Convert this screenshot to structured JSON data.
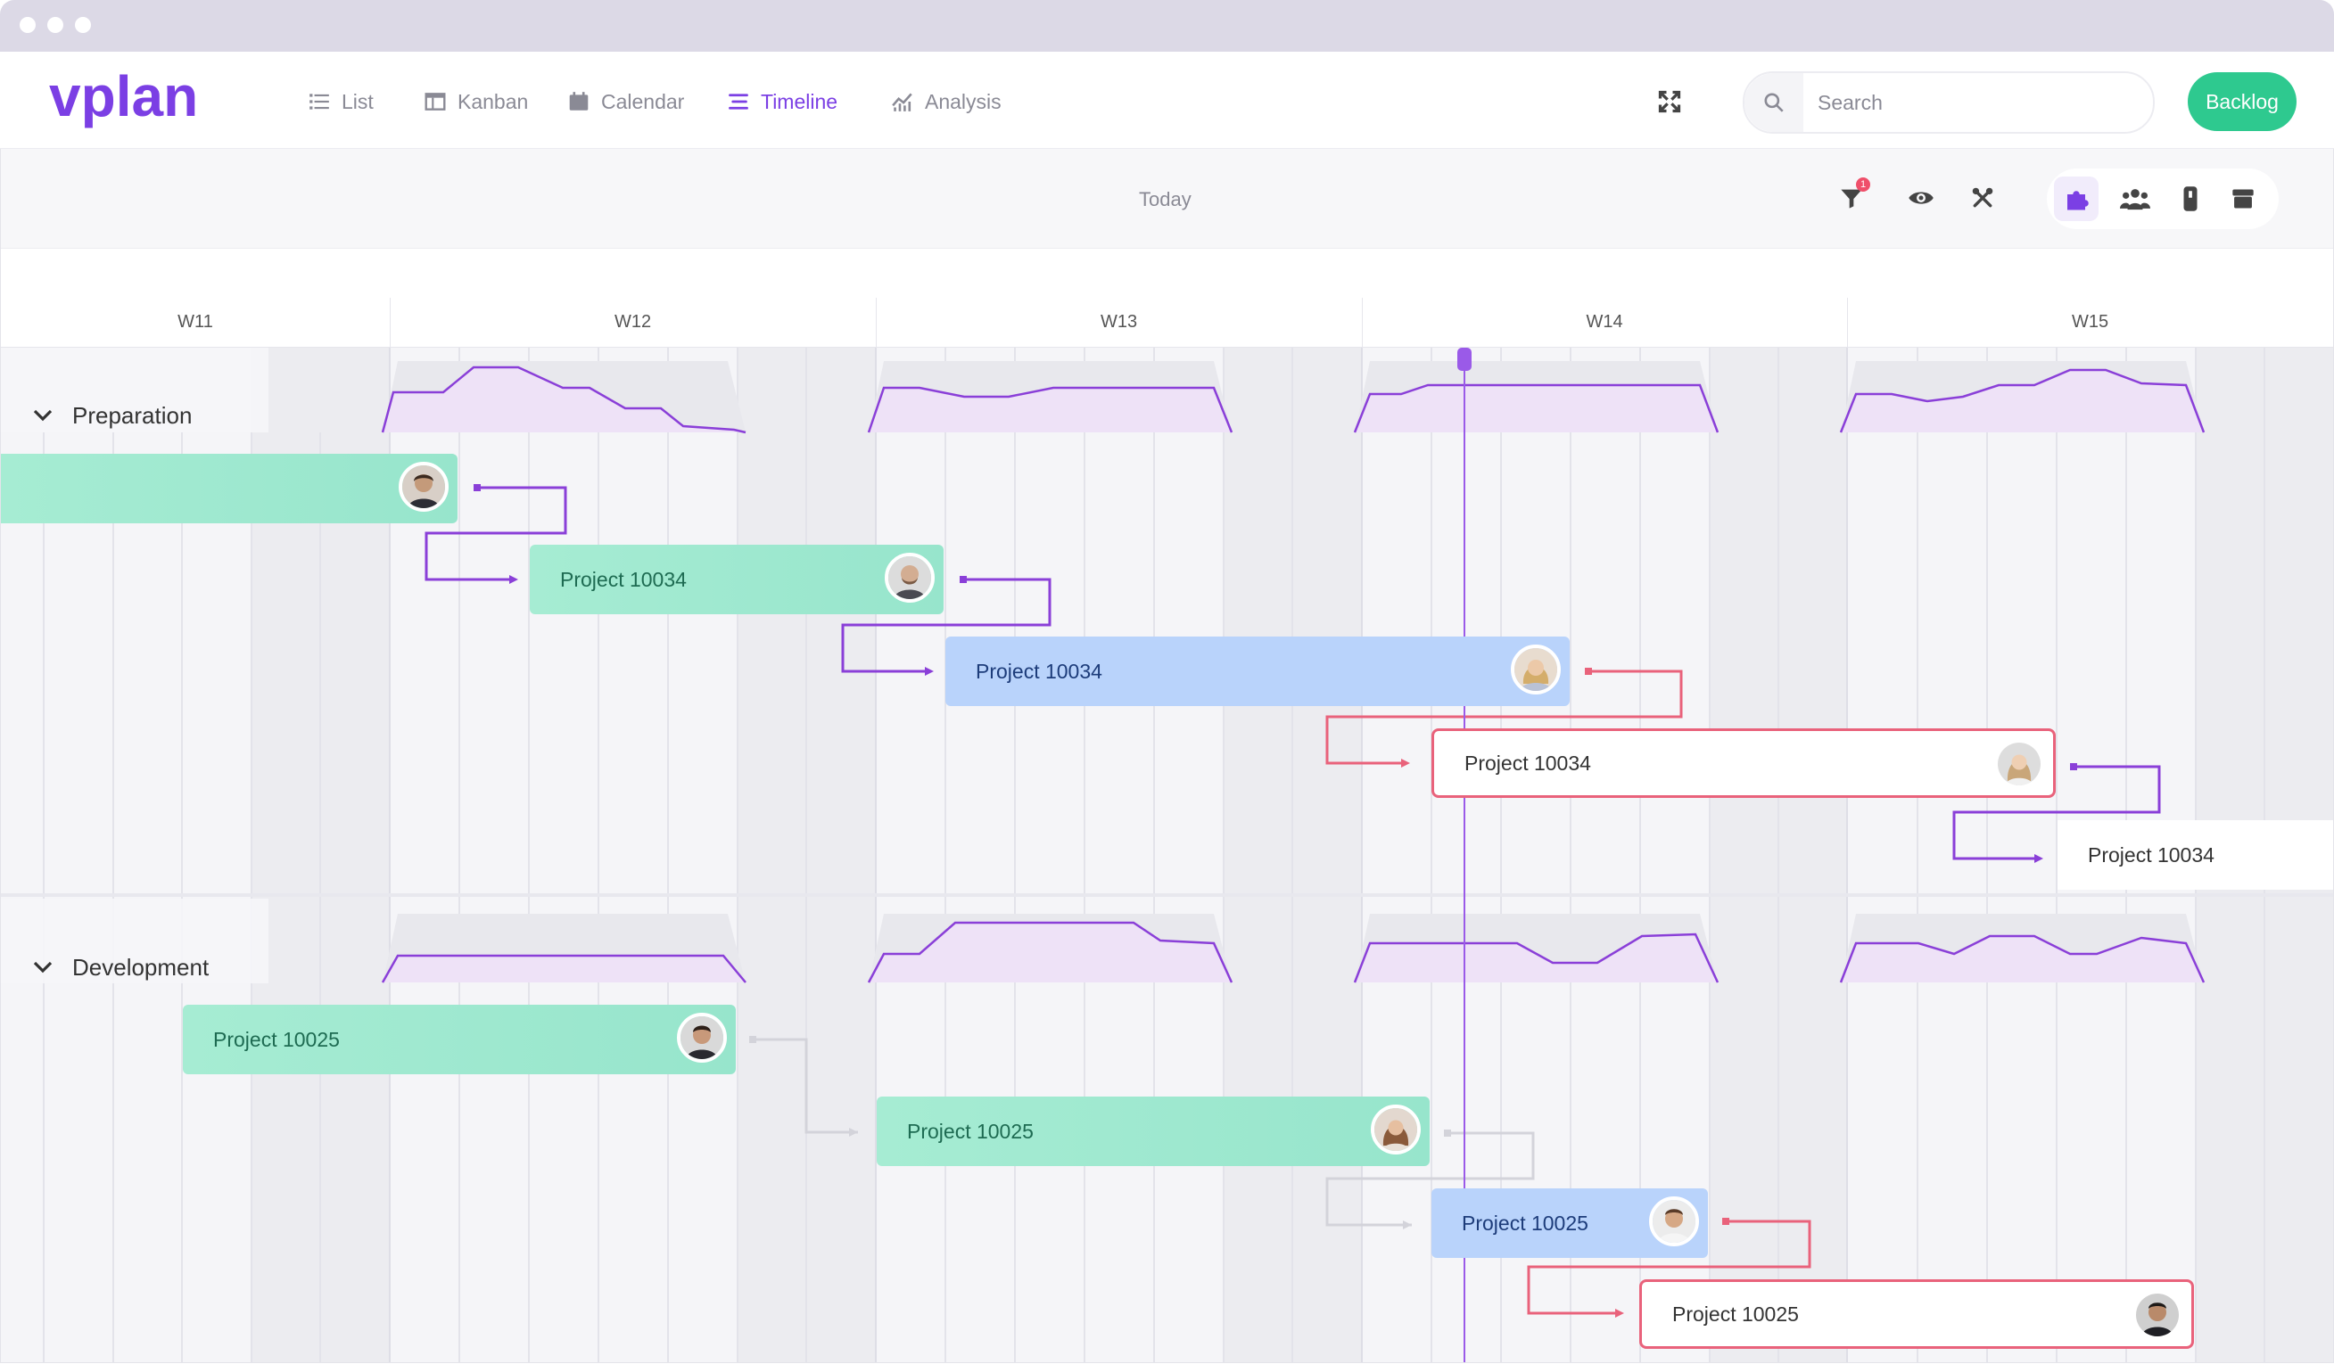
{
  "app": {
    "logo_text": "vplan",
    "nav": [
      {
        "label": "List",
        "icon": "list-icon"
      },
      {
        "label": "Kanban",
        "icon": "kanban-icon"
      },
      {
        "label": "Calendar",
        "icon": "calendar-icon"
      },
      {
        "label": "Timeline",
        "icon": "timeline-icon",
        "active": true
      },
      {
        "label": "Analysis",
        "icon": "analysis-icon"
      }
    ],
    "search": {
      "placeholder": "Search"
    },
    "backlog_label": "Backlog"
  },
  "toolbar": {
    "today_label": "Today",
    "filter_badge": "1",
    "icons": [
      "filter-icon",
      "eye-icon",
      "tools-icon",
      "puzzle-icon",
      "team-icon",
      "device-icon",
      "archive-icon"
    ]
  },
  "timeline": {
    "weeks": [
      "W11",
      "W12",
      "W13",
      "W14",
      "W15"
    ],
    "groups": [
      {
        "name": "Preparation",
        "bars": [
          {
            "label": "",
            "style": "green"
          },
          {
            "label": "Project 10034",
            "style": "green"
          },
          {
            "label": "Project 10034",
            "style": "blue"
          },
          {
            "label": "Project 10034",
            "style": "outline"
          },
          {
            "label": "Project 10034",
            "style": "plain"
          }
        ]
      },
      {
        "name": "Development",
        "bars": [
          {
            "label": "Project 10025",
            "style": "green"
          },
          {
            "label": "Project 10025",
            "style": "green"
          },
          {
            "label": "Project 10025",
            "style": "blue"
          },
          {
            "label": "Project 10025",
            "style": "outline"
          }
        ]
      }
    ]
  },
  "colors": {
    "accent": "#7b3fe4",
    "green": "#2ec98f",
    "dependency_purple": "#8a3fd8",
    "dependency_red": "#e9627b"
  }
}
